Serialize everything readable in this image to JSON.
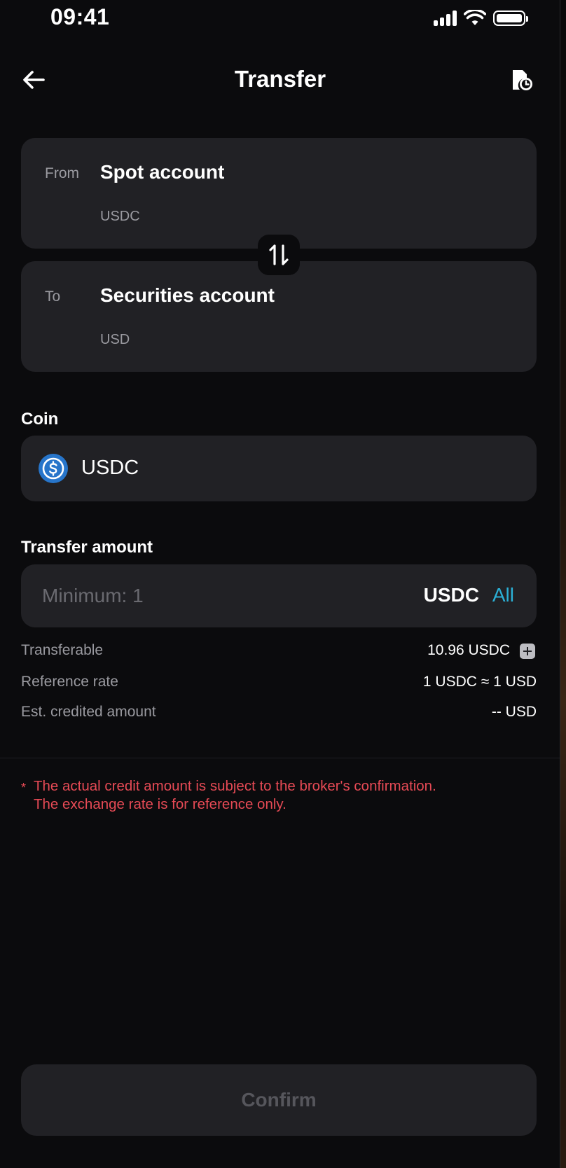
{
  "status_bar": {
    "time": "09:41"
  },
  "header": {
    "title": "Transfer",
    "back_icon": "arrow-left-icon",
    "history_icon": "document-clock-icon"
  },
  "from_account": {
    "label": "From",
    "name": "Spot account",
    "currency": "USDC"
  },
  "to_account": {
    "label": "To",
    "name": "Securities account",
    "currency": "USD"
  },
  "swap_icon": "swap-vertical-icon",
  "coin": {
    "label": "Coin",
    "selected": "USDC",
    "icon": "usdc-coin-icon",
    "icon_color": "#2775ca"
  },
  "amount": {
    "label": "Transfer amount",
    "placeholder": "Minimum: 1",
    "value": "",
    "unit": "USDC",
    "all_label": "All"
  },
  "info": {
    "transferable_label": "Transferable",
    "transferable_value": "10.96 USDC",
    "rate_label": "Reference rate",
    "rate_value": "1 USDC ≈ 1 USD",
    "credited_label": "Est. credited amount",
    "credited_value": "-- USD"
  },
  "notice": {
    "star": "*",
    "line1": "The actual credit amount is subject to the broker's confirmation.",
    "line2": "The exchange rate is for reference only."
  },
  "confirm_label": "Confirm",
  "colors": {
    "background": "#0b0b0d",
    "card": "#212125",
    "accent": "#2bb0d6",
    "warning": "#e64a55"
  }
}
